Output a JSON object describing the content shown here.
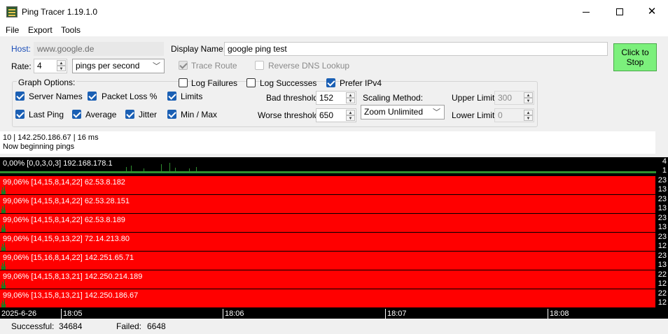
{
  "window": {
    "title": "Ping Tracer 1.19.1.0"
  },
  "menu": {
    "items": [
      "File",
      "Export",
      "Tools"
    ]
  },
  "host": {
    "label": "Host:",
    "value": "www.google.de"
  },
  "display_name": {
    "label": "Display Name:",
    "value": "google ping test"
  },
  "rate": {
    "label": "Rate:",
    "value": "4",
    "unit": "pings per second"
  },
  "options": {
    "trace_route": {
      "label": "Trace Route",
      "checked": true,
      "enabled": false
    },
    "reverse_dns": {
      "label": "Reverse DNS Lookup",
      "checked": false,
      "enabled": false
    },
    "log_failures": {
      "label": "Log Failures",
      "checked": false
    },
    "log_successes": {
      "label": "Log Successes",
      "checked": false
    },
    "prefer_ipv4": {
      "label": "Prefer IPv4",
      "checked": true
    }
  },
  "graph_options": {
    "title": "Graph Options:",
    "server_names": {
      "label": "Server Names",
      "checked": true
    },
    "packet_loss": {
      "label": "Packet Loss %",
      "checked": true
    },
    "limits": {
      "label": "Limits",
      "checked": true
    },
    "last_ping": {
      "label": "Last Ping",
      "checked": true
    },
    "average": {
      "label": "Average",
      "checked": true
    },
    "jitter": {
      "label": "Jitter",
      "checked": true
    },
    "min_max": {
      "label": "Min / Max",
      "checked": true
    }
  },
  "thresholds": {
    "bad_label": "Bad threshold:",
    "bad_value": "152",
    "worse_label": "Worse threshold:",
    "worse_value": "650"
  },
  "scaling": {
    "label": "Scaling Method:",
    "value": "Zoom Unlimited"
  },
  "limits": {
    "upper_label": "Upper Limit:",
    "upper_value": "300",
    "lower_label": "Lower Limit:",
    "lower_value": "0"
  },
  "stop_button": {
    "line1": "Click to",
    "line2": "Stop"
  },
  "log": {
    "lines": [
      "10 | 142.250.186.67 | 16 ms",
      "Now beginning pings"
    ]
  },
  "graphs": [
    {
      "label": "0,00% [0,0,3,0,3] 192.168.178.1",
      "max": "4",
      "min": "1",
      "status": "ok"
    },
    {
      "label": "99,06% [14,15,8,14,22] 62.53.8.182",
      "max": "23",
      "min": "13",
      "status": "bad"
    },
    {
      "label": "99,06% [14,15,8,14,22] 62.53.28.151",
      "max": "23",
      "min": "13",
      "status": "bad"
    },
    {
      "label": "99,06% [14,15,8,14,22] 62.53.8.189",
      "max": "23",
      "min": "13",
      "status": "bad"
    },
    {
      "label": "99,06% [14,15,9,13,22] 72.14.213.80",
      "max": "23",
      "min": "12",
      "status": "bad"
    },
    {
      "label": "99,06% [15,16,8,14,22] 142.251.65.71",
      "max": "23",
      "min": "13",
      "status": "bad"
    },
    {
      "label": "99,06% [14,15,8,13,21] 142.250.214.189",
      "max": "22",
      "min": "12",
      "status": "bad"
    },
    {
      "label": "99,06% [13,15,8,13,21] 142.250.186.67",
      "max": "22",
      "min": "12",
      "status": "bad"
    }
  ],
  "time_axis": {
    "ticks": [
      "2025-6-26",
      "18:05",
      "18:06",
      "18:07",
      "18:08"
    ]
  },
  "status": {
    "successful_label": "Successful:",
    "successful_value": "34684",
    "failed_label": "Failed:",
    "failed_value": "6648"
  },
  "colors": {
    "bad": "#ff0000",
    "ok_line": "#2f8f2f",
    "stop_button": "#7cf07c",
    "host_label": "#1a4db8"
  }
}
